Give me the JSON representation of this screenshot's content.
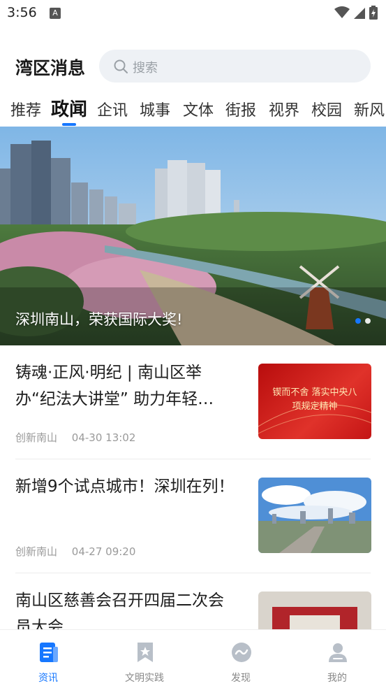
{
  "status_bar": {
    "time": "3:56",
    "notification_glyph": "A"
  },
  "header": {
    "title": "湾区消息",
    "search_placeholder": "搜索"
  },
  "tabs": [
    {
      "label": "推荐",
      "active": false
    },
    {
      "label": "政闻",
      "active": true
    },
    {
      "label": "企讯",
      "active": false
    },
    {
      "label": "城事",
      "active": false
    },
    {
      "label": "文体",
      "active": false
    },
    {
      "label": "街报",
      "active": false
    },
    {
      "label": "视界",
      "active": false
    },
    {
      "label": "校园",
      "active": false
    },
    {
      "label": "新风",
      "active": false
    }
  ],
  "banner": {
    "caption": "深圳南山，荣获国际大奖!",
    "current_slide": 1,
    "slide_count": 2
  },
  "news": [
    {
      "title": "铸魂·正风·明纪 | 南山区举办“纪法大讲堂” 助力年轻…",
      "source": "创新南山",
      "time": "04-30 13:02",
      "thumb_text": "锲而不舍 落实中央八项规定精神"
    },
    {
      "title": "新增9个试点城市！深圳在列！",
      "source": "创新南山",
      "time": "04-27 09:20"
    },
    {
      "title": "南山区慈善会召开四届二次会员大会",
      "source": "",
      "time": ""
    }
  ],
  "bottom_nav": [
    {
      "label": "资讯",
      "icon": "news-icon",
      "active": true
    },
    {
      "label": "文明实践",
      "icon": "bookmark-star-icon",
      "active": false
    },
    {
      "label": "发现",
      "icon": "discover-icon",
      "active": false
    },
    {
      "label": "我的",
      "icon": "profile-icon",
      "active": false
    }
  ],
  "colors": {
    "accent": "#1677ff",
    "search_bg": "#eef1f5"
  }
}
